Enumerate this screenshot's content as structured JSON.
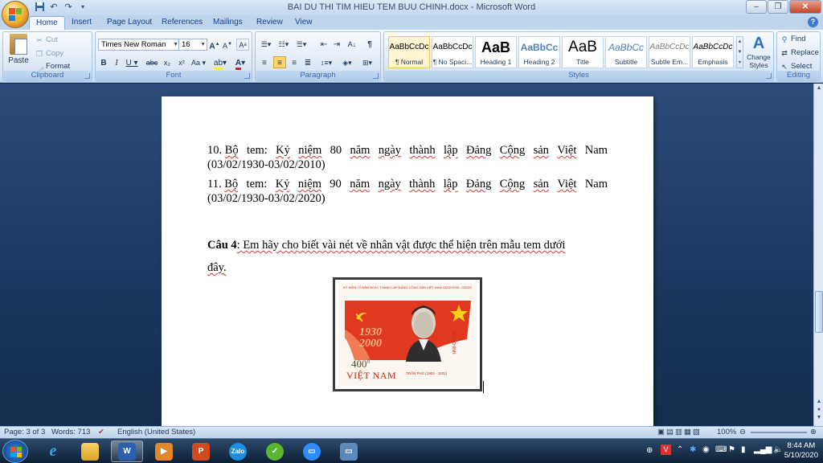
{
  "window": {
    "title": "BAI DU THI TIM HIEU TEM BUU CHINH.docx - Microsoft Word"
  },
  "tabs": [
    "Home",
    "Insert",
    "Page Layout",
    "References",
    "Mailings",
    "Review",
    "View"
  ],
  "ribbon": {
    "clipboard": {
      "label": "Clipboard",
      "paste": "Paste",
      "cut": "Cut",
      "copy": "Copy",
      "format_painter": "Format Painter"
    },
    "font": {
      "label": "Font",
      "font_name": "Times New Roman",
      "font_size": "16"
    },
    "paragraph": {
      "label": "Paragraph"
    },
    "styles": {
      "label": "Styles",
      "items": [
        {
          "sample": "AaBbCcDc",
          "name": "¶ Normal"
        },
        {
          "sample": "AaBbCcDc",
          "name": "¶ No Spaci..."
        },
        {
          "sample": "AaB",
          "name": "Heading 1"
        },
        {
          "sample": "AaBbCc",
          "name": "Heading 2"
        },
        {
          "sample": "AaB",
          "name": "Title"
        },
        {
          "sample": "AaBbCc",
          "name": "Subtitle"
        },
        {
          "sample": "AaBbCcDc",
          "name": "Subtle Em..."
        },
        {
          "sample": "AaBbCcDc",
          "name": "Emphasis"
        }
      ],
      "change_styles": "Change Styles"
    },
    "editing": {
      "label": "Editing",
      "find": "Find",
      "replace": "Replace",
      "select": "Select"
    }
  },
  "document": {
    "line10_prefix": "10. ",
    "line10_words": [
      "Bộ",
      "tem:",
      "Kỷ",
      "niệm",
      "80",
      "năm",
      "ngày",
      "thành",
      "lập",
      "Đảng",
      "Cộng",
      "sản",
      "Việt",
      "Nam"
    ],
    "line10_date": "(03/02/1930-03/02/2010)",
    "line11_prefix": "11. ",
    "line11_words": [
      "Bộ",
      "tem:",
      "Kỷ",
      "niệm",
      "90",
      "năm",
      "ngày",
      "thành",
      "lập",
      "Đảng",
      "Cộng",
      "sản",
      "Việt",
      "Nam"
    ],
    "line11_date": "(03/02/1930-03/02/2020)",
    "q4_label": "Câu 4",
    "q4_text": ": Em hãy cho biết vài nét về nhân vật được thể hiện trên mẫu tem dưới",
    "q4_text2": "đây."
  },
  "stamp": {
    "header": "KỶ NIỆM 70 NĂM NGÀY THÀNH LẬP ĐẢNG CỘNG SẢN VIỆT NAM 03/02/1930 - 03/02/2000",
    "year1": "1930",
    "year2": "2000",
    "value": "400",
    "value_unit": "đ",
    "country": "VIỆT NAM",
    "side": "BƯU CHÍNH",
    "person": "TRẦN PHÚ (1904 - 1931)",
    "colors": {
      "red": "#e0391f",
      "yellow": "#f7d117"
    }
  },
  "statusbar": {
    "page": "Page: 3 of 3",
    "words": "Words: 713",
    "language": "English (United States)",
    "zoom": "100%"
  },
  "taskbar": {
    "time": "8:44 AM",
    "date": "5/10/2020",
    "apps": [
      "internet-explorer",
      "file-explorer",
      "word",
      "media-player",
      "powerpoint",
      "zalo",
      "coccoc",
      "zoom",
      "network-app"
    ]
  }
}
